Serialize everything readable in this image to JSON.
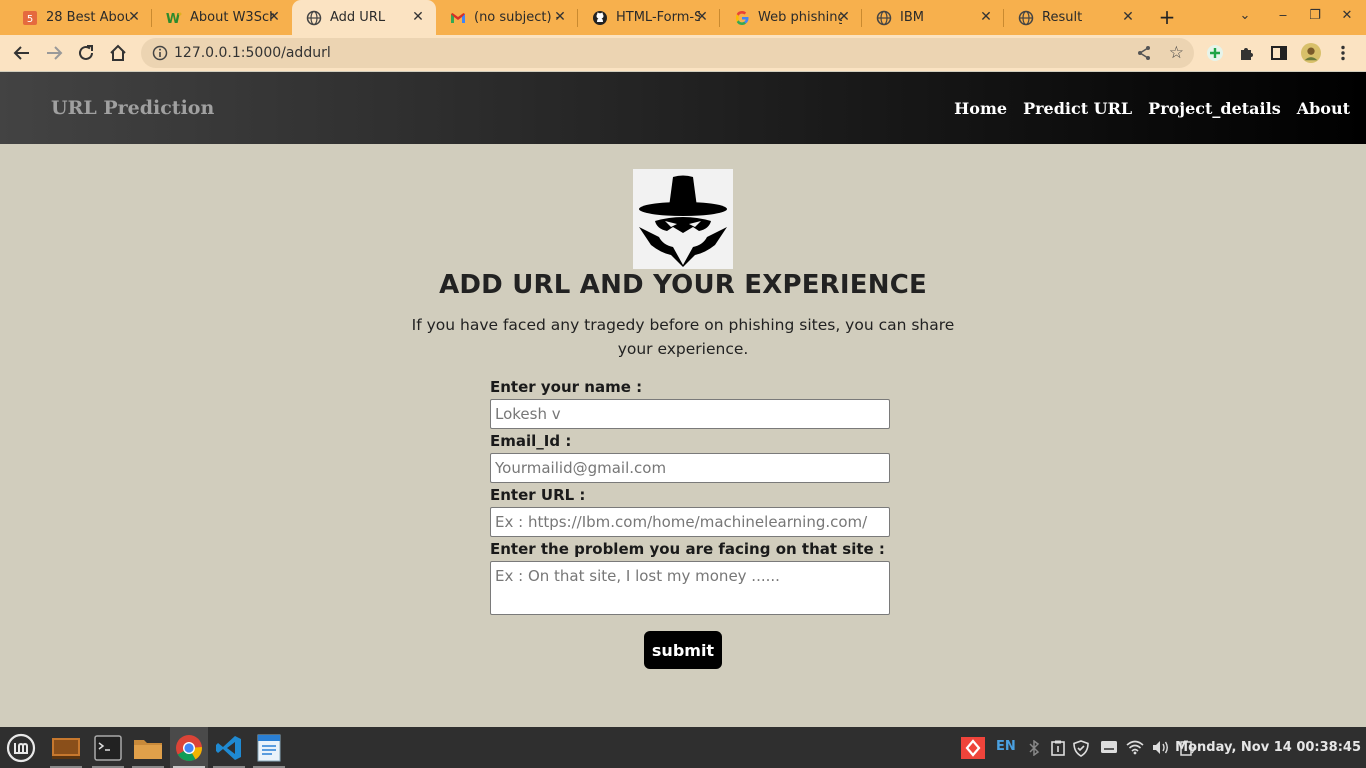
{
  "browser": {
    "tabs": [
      {
        "title": "28 Best Abou",
        "favicon": "html5-icon"
      },
      {
        "title": "About W3Sch",
        "favicon": "w3schools-icon"
      },
      {
        "title": "Add URL",
        "favicon": "globe-icon",
        "active": true
      },
      {
        "title": "(no subject) -",
        "favicon": "gmail-icon"
      },
      {
        "title": "HTML-Form-S",
        "favicon": "github-icon"
      },
      {
        "title": "Web phishing",
        "favicon": "google-icon"
      },
      {
        "title": "IBM",
        "favicon": "globe-icon"
      },
      {
        "title": "Result",
        "favicon": "globe-icon"
      }
    ],
    "url": "127.0.0.1:5000/addurl",
    "colors": {
      "tabstrip": "#f7b04d",
      "toolbar": "#fbe3c2"
    }
  },
  "site": {
    "brand": "URL Prediction",
    "nav": [
      "Home",
      "Predict URL",
      "Project_details",
      "About"
    ]
  },
  "main": {
    "logo": "spy-hat-icon",
    "title": "ADD URL AND YOUR EXPERIENCE",
    "description": "If you have faced any tragedy before on phishing sites, you can share your experience.",
    "fields": {
      "name": {
        "label": "Enter your name :",
        "placeholder": "Lokesh v"
      },
      "email": {
        "label": "Email_Id :",
        "placeholder": "Yourmailid@gmail.com"
      },
      "url": {
        "label": "Enter URL :",
        "placeholder": "Ex : https://Ibm.com/home/machinelearning.com/"
      },
      "problem": {
        "label": "Enter the problem you are facing on that site :",
        "placeholder": "Ex : On that site, I lost my money ......"
      }
    },
    "submit_label": "submit"
  },
  "taskbar": {
    "apps": [
      "mint-menu-icon",
      "desktop-icon",
      "terminal-icon",
      "files-icon",
      "chrome-icon",
      "vscode-icon",
      "writer-icon"
    ],
    "language": "EN",
    "clock": "Monday, Nov 14 00:38:45"
  }
}
